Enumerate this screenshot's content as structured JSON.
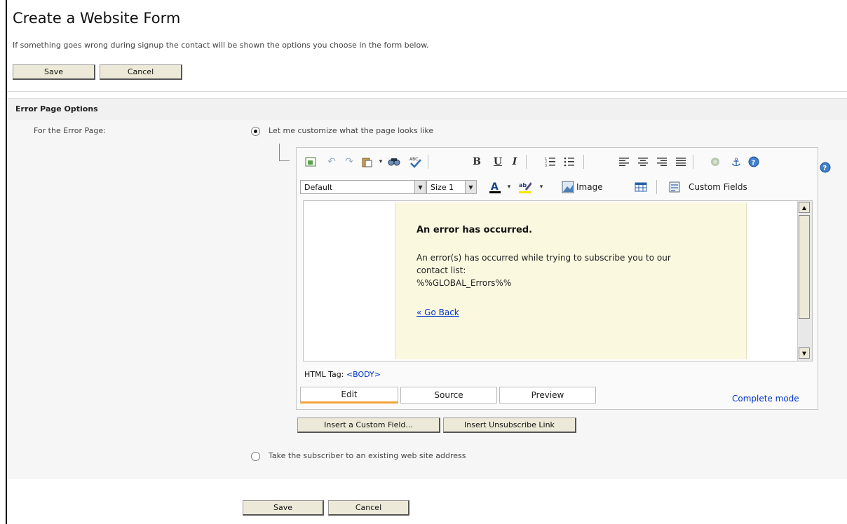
{
  "page": {
    "title": "Create a Website Form",
    "intro": "If something goes wrong during signup the contact will be shown the options you choose in the form below."
  },
  "buttons": {
    "save": "Save",
    "cancel": "Cancel"
  },
  "section": {
    "heading": "Error Page Options",
    "field_label": "For the Error Page:",
    "option_customize": "Let me customize what the page looks like",
    "option_redirect": "Take the subscriber to an existing web site address",
    "selected_option": "customize"
  },
  "editor": {
    "format_select": "Default",
    "size_select": "Size 1",
    "image_label": "Image",
    "custom_fields_label": "Custom Fields",
    "content": {
      "heading": "An error has occurred.",
      "line1": "An error(s) has occurred while trying to subscribe you to our",
      "line2": "contact list:",
      "line3": "%%GLOBAL_Errors%%",
      "back_link": "« Go Back"
    },
    "html_tag_label": "HTML Tag:",
    "html_tag_value": "<BODY>",
    "tabs": [
      "Edit",
      "Source",
      "Preview"
    ],
    "active_tab": "Edit",
    "complete_mode": "Complete mode"
  },
  "insert_buttons": {
    "custom_field": "Insert a Custom Field...",
    "unsubscribe": "Insert Unsubscribe Link"
  },
  "colors": {
    "accent_tab": "#f2a33a",
    "link": "#0033cc",
    "content_bg": "#fbf8e0"
  }
}
